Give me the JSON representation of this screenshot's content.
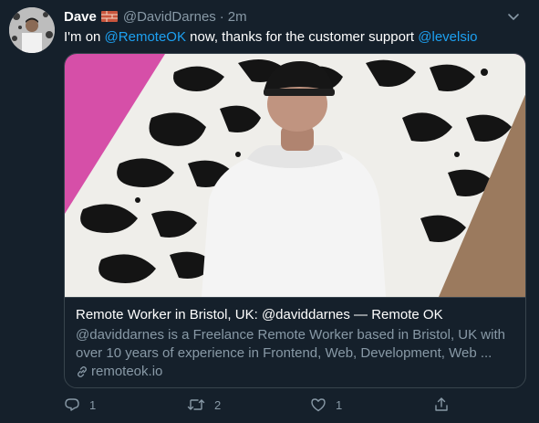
{
  "tweet": {
    "author_name": "Dave",
    "author_handle": "@DavidDarnes",
    "separator": "·",
    "time": "2m",
    "text_parts": {
      "before": "I'm on ",
      "mention1": "@RemoteOK",
      "middle": " now, thanks for the customer support ",
      "mention2": "@levelsio"
    },
    "card": {
      "title": "Remote Worker in Bristol, UK: @daviddarnes — Remote OK",
      "description": "@daviddarnes is a Freelance Remote Worker based in Bristol, UK with over 10 years of experience in Frontend, Web, Development, Web ...",
      "domain": "remoteok.io"
    },
    "actions": {
      "reply_count": "1",
      "retweet_count": "2",
      "like_count": "1"
    }
  },
  "icons": {
    "emoji": "brick-emoji",
    "caret": "chevron-down-icon",
    "reply": "reply-icon",
    "retweet": "retweet-icon",
    "like": "heart-icon",
    "share": "share-icon",
    "link": "link-icon"
  },
  "colors": {
    "background": "#15202b",
    "accent": "#1da1f2",
    "secondary_text": "#8899a6",
    "border": "#38444d"
  }
}
